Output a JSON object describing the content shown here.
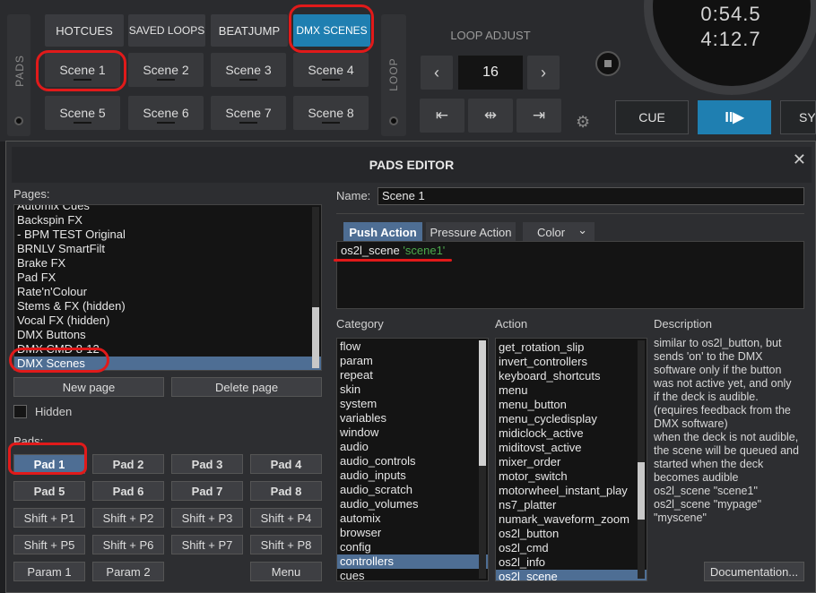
{
  "deck": {
    "mode_tabs": [
      {
        "label": "HOTCUES",
        "active": false
      },
      {
        "label": "SAVED LOOPS",
        "active": false
      },
      {
        "label": "BEATJUMP",
        "active": false
      },
      {
        "label": "DMX SCENES",
        "active": true
      }
    ],
    "pads_side_label": "PADS",
    "loop_side_label": "LOOP",
    "scenes": [
      "Scene 1",
      "Scene 2",
      "Scene 3",
      "Scene 4",
      "Scene 5",
      "Scene 6",
      "Scene 7",
      "Scene 8"
    ],
    "loop_adjust_label": "LOOP ADJUST",
    "loop_value": "16",
    "loop_prev_icon": "‹",
    "loop_next_icon": "›",
    "loop_controls": [
      "⇤",
      "⇹",
      "⇥"
    ],
    "time_elapsed": "0:54.5",
    "time_remaining": "4:12.7",
    "cue_label": "CUE",
    "play_label": "II▶",
    "sync_label": "SY"
  },
  "pads_editor": {
    "title": "PADS EDITOR",
    "close_icon": "✕",
    "pages_label": "Pages:",
    "pages": [
      "Automix Cues",
      "Backspin FX",
      "- BPM TEST Original",
      "BRNLV SmartFilt",
      "Brake FX",
      "Pad FX",
      "Rate'n'Colour",
      "Stems & FX (hidden)",
      "Vocal FX (hidden)",
      "DMX Buttons",
      "DMX CMD 8-12",
      "DMX Scenes"
    ],
    "selected_page": "DMX Scenes",
    "new_page_label": "New page",
    "delete_page_label": "Delete page",
    "hidden_label": "Hidden",
    "pads_label": "Pads:",
    "pads": [
      "Pad 1",
      "Pad 2",
      "Pad 3",
      "Pad 4",
      "Pad 5",
      "Pad 6",
      "Pad 7",
      "Pad 8",
      "Shift + P1",
      "Shift + P2",
      "Shift + P3",
      "Shift + P4",
      "Shift + P5",
      "Shift + P6",
      "Shift + P7",
      "Shift + P8"
    ],
    "selected_pad": "Pad 1",
    "param1_label": "Param 1",
    "param2_label": "Param 2",
    "menu_label": "Menu",
    "name_label": "Name:",
    "name_value": "Scene 1",
    "action_tabs": [
      "Push Action",
      "Pressure Action",
      "Color"
    ],
    "active_action_tab": "Push Action",
    "color_dropdown_icon": "⌄",
    "script_command": "os2l_scene",
    "script_argument": "'scene1'",
    "category_label": "Category",
    "categories": [
      "flow",
      "param",
      "repeat",
      "skin",
      "system",
      "variables",
      "window",
      "audio",
      "audio_controls",
      "audio_inputs",
      "audio_scratch",
      "audio_volumes",
      "automix",
      "browser",
      "config",
      "controllers",
      "cues"
    ],
    "selected_category": "controllers",
    "action_label": "Action",
    "actions": [
      "get_rotation_slip",
      "invert_controllers",
      "keyboard_shortcuts",
      "menu",
      "menu_button",
      "menu_cycledisplay",
      "midiclock_active",
      "miditovst_active",
      "mixer_order",
      "motor_switch",
      "motorwheel_instant_play",
      "ns7_platter",
      "numark_waveform_zoom",
      "os2l_button",
      "os2l_cmd",
      "os2l_info",
      "os2l_scene"
    ],
    "selected_action": "os2l_scene",
    "description_label": "Description",
    "description_lines": [
      "similar to os2l_button, but",
      "sends 'on' to the DMX",
      "software only if the button",
      "was not active yet, and only",
      "if the deck is audible.",
      "(requires feedback from the",
      "DMX software)",
      "when the deck is not audible,",
      "the scene will be queued and",
      "started when the deck",
      "becomes audible",
      "os2l_scene \"scene1\"",
      "os2l_scene \"mypage\"",
      "\"myscene\""
    ],
    "documentation_label": "Documentation..."
  },
  "colors": {
    "accent": "#1f7fb1",
    "selection": "#4e6e94",
    "annotation": "#e11a1a",
    "script_argument": "#4caa4c"
  }
}
